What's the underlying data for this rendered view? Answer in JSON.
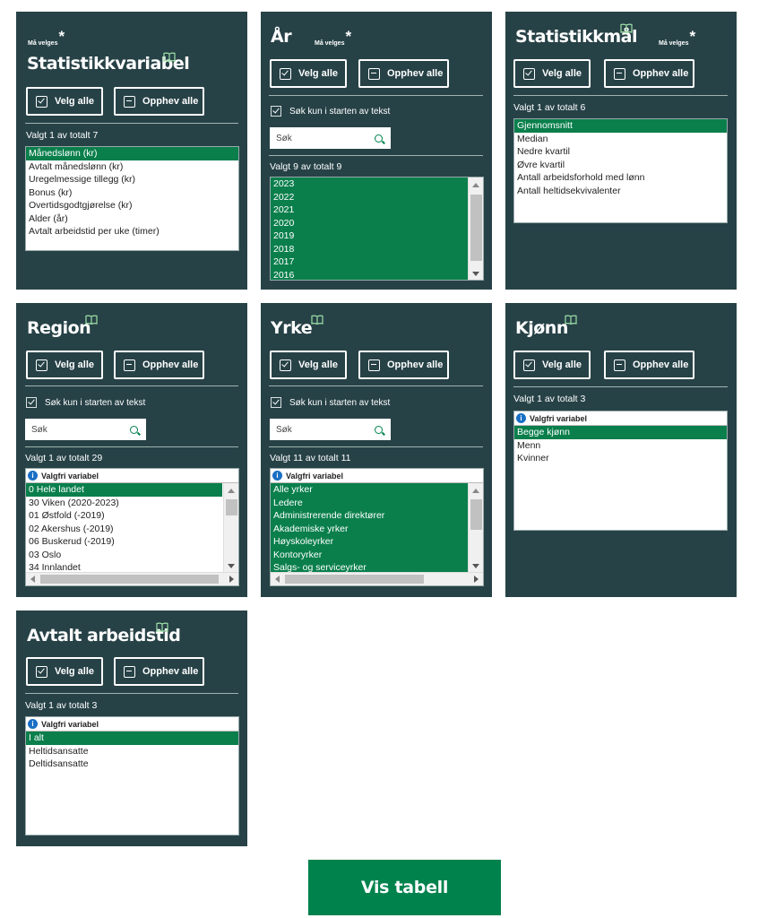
{
  "common": {
    "must_select": "Må velges",
    "star": "*",
    "select_all": "Velg alle",
    "deselect_all": "Opphev alle",
    "search_start_only": "Søk kun i starten av tekst",
    "search_placeholder": "Søk",
    "optional_variable": "Valgfri variabel",
    "info_glyph": "i"
  },
  "colors": {
    "panel_bg": "#274247",
    "selected": "#0a7f4c",
    "button_green": "#00824d",
    "info_blue": "#1a6fc4"
  },
  "panels": {
    "statistikkvariabel": {
      "title": "Statistikkvariabel",
      "count": "Valgt 1 av totalt 7",
      "items": [
        "Månedslønn (kr)",
        "Avtalt månedslønn (kr)",
        "Uregelmessige tillegg (kr)",
        "Bonus (kr)",
        "Overtidsgodtgjørelse (kr)",
        "Alder (år)",
        "Avtalt arbeidstid per uke (timer)"
      ]
    },
    "aar": {
      "title": "År",
      "count": "Valgt 9 av totalt 9",
      "items": [
        "2023",
        "2022",
        "2021",
        "2020",
        "2019",
        "2018",
        "2017",
        "2016"
      ]
    },
    "statistikkmaal": {
      "title": "Statistikkmål",
      "count": "Valgt 1 av totalt 6",
      "items": [
        "Gjennomsnitt",
        "Median",
        "Nedre kvartil",
        "Øvre kvartil",
        "Antall arbeidsforhold med lønn",
        "Antall heltidsekvivalenter"
      ]
    },
    "region": {
      "title": "Region",
      "count": "Valgt 1 av totalt 29",
      "items": [
        "0 Hele landet",
        "30 Viken (2020-2023)",
        "01 Østfold (-2019)",
        "02 Akershus (-2019)",
        "06 Buskerud (-2019)",
        "03 Oslo",
        "34 Innlandet"
      ]
    },
    "yrke": {
      "title": "Yrke",
      "count": "Valgt 11 av totalt 11",
      "items": [
        "Alle yrker",
        "Ledere",
        "Administrerende direktører",
        "Akademiske yrker",
        "Høyskoleyrker",
        "Kontoryrker",
        "Salgs- og serviceyrker"
      ]
    },
    "kjonn": {
      "title": "Kjønn",
      "count": "Valgt 1 av totalt 3",
      "items": [
        "Begge kjønn",
        "Menn",
        "Kvinner"
      ]
    },
    "arbeidstid": {
      "title": "Avtalt arbeidstid",
      "count": "Valgt 1 av totalt 3",
      "items": [
        "I alt",
        "Heltidsansatte",
        "Deltidsansatte"
      ]
    }
  },
  "show_table_button": "Vis tabell"
}
